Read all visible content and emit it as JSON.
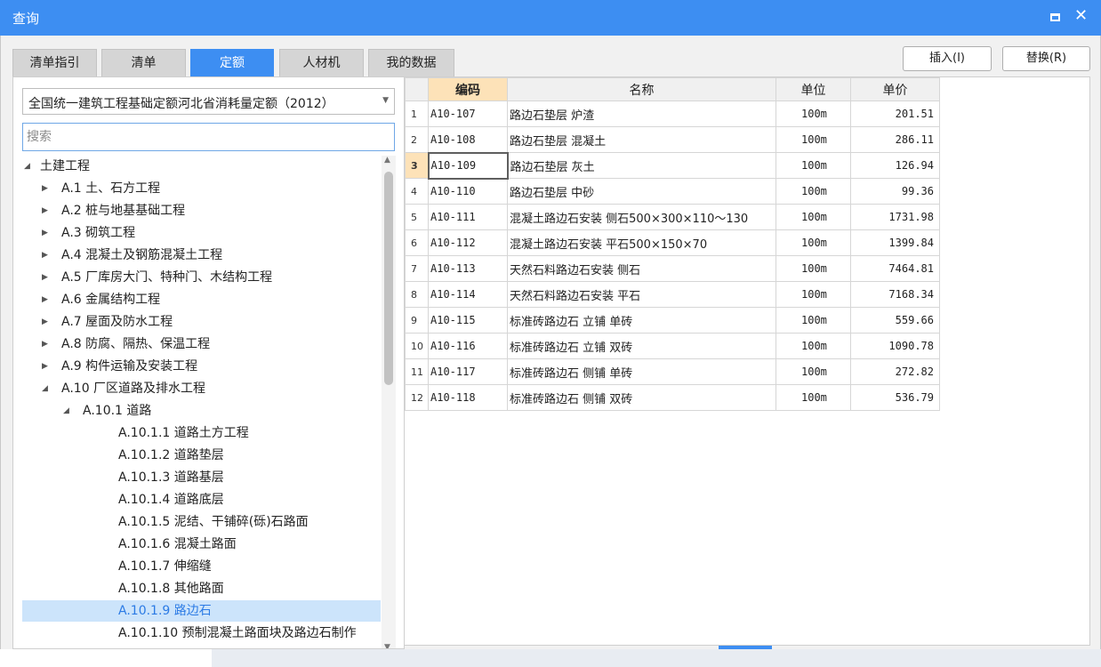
{
  "window": {
    "title": "查询"
  },
  "tabs": [
    {
      "label": "清单指引",
      "active": false
    },
    {
      "label": "清单",
      "active": false
    },
    {
      "label": "定额",
      "active": true
    },
    {
      "label": "人材机",
      "active": false
    },
    {
      "label": "我的数据",
      "active": false
    }
  ],
  "actions": {
    "insert_label": "插入(I)",
    "replace_label": "替换(R)"
  },
  "left": {
    "dropdown_value": "全国统一建筑工程基础定额河北省消耗量定额（2012）",
    "search_placeholder": "搜索"
  },
  "tree": [
    {
      "label": "土建工程",
      "level": 0,
      "arrow": "expanded"
    },
    {
      "label": "A.1 土、石方工程",
      "level": 1,
      "arrow": "collapsed"
    },
    {
      "label": "A.2 桩与地基基础工程",
      "level": 1,
      "arrow": "collapsed"
    },
    {
      "label": "A.3 砌筑工程",
      "level": 1,
      "arrow": "collapsed"
    },
    {
      "label": "A.4 混凝土及钢筋混凝土工程",
      "level": 1,
      "arrow": "collapsed"
    },
    {
      "label": "A.5 厂库房大门、特种门、木结构工程",
      "level": 1,
      "arrow": "collapsed"
    },
    {
      "label": "A.6 金属结构工程",
      "level": 1,
      "arrow": "collapsed"
    },
    {
      "label": "A.7 屋面及防水工程",
      "level": 1,
      "arrow": "collapsed"
    },
    {
      "label": "A.8 防腐、隔热、保温工程",
      "level": 1,
      "arrow": "collapsed"
    },
    {
      "label": "A.9 构件运输及安装工程",
      "level": 1,
      "arrow": "collapsed"
    },
    {
      "label": "A.10 厂区道路及排水工程",
      "level": 1,
      "arrow": "expanded"
    },
    {
      "label": "A.10.1 道路",
      "level": 2,
      "arrow": "expanded"
    },
    {
      "label": "A.10.1.1 道路土方工程",
      "level": 3,
      "arrow": ""
    },
    {
      "label": "A.10.1.2 道路垫层",
      "level": 3,
      "arrow": ""
    },
    {
      "label": "A.10.1.3 道路基层",
      "level": 3,
      "arrow": ""
    },
    {
      "label": "A.10.1.4 道路底层",
      "level": 3,
      "arrow": ""
    },
    {
      "label": "A.10.1.5 泥结、干铺碎(砾)石路面",
      "level": 3,
      "arrow": ""
    },
    {
      "label": "A.10.1.6 混凝土路面",
      "level": 3,
      "arrow": ""
    },
    {
      "label": "A.10.1.7 伸缩缝",
      "level": 3,
      "arrow": ""
    },
    {
      "label": "A.10.1.8 其他路面",
      "level": 3,
      "arrow": ""
    },
    {
      "label": "A.10.1.9 路边石",
      "level": 3,
      "arrow": "",
      "selected": true
    },
    {
      "label": "A.10.1.10 预制混凝土路面块及路边石制作",
      "level": 3,
      "arrow": ""
    }
  ],
  "table": {
    "headers": {
      "code": "编码",
      "name": "名称",
      "unit": "单位",
      "price": "单价"
    },
    "rows": [
      {
        "num": "1",
        "code": "A10-107",
        "name": "路边石垫层 炉渣",
        "unit": "100m",
        "price": "201.51"
      },
      {
        "num": "2",
        "code": "A10-108",
        "name": "路边石垫层 混凝土",
        "unit": "100m",
        "price": "286.11"
      },
      {
        "num": "3",
        "code": "A10-109",
        "name": "路边石垫层 灰土",
        "unit": "100m",
        "price": "126.94",
        "current": true
      },
      {
        "num": "4",
        "code": "A10-110",
        "name": "路边石垫层 中砂",
        "unit": "100m",
        "price": "99.36"
      },
      {
        "num": "5",
        "code": "A10-111",
        "name": "混凝土路边石安装 侧石500×300×110～130",
        "unit": "100m",
        "price": "1731.98"
      },
      {
        "num": "6",
        "code": "A10-112",
        "name": "混凝土路边石安装 平石500×150×70",
        "unit": "100m",
        "price": "1399.84"
      },
      {
        "num": "7",
        "code": "A10-113",
        "name": "天然石料路边石安装 侧石",
        "unit": "100m",
        "price": "7464.81"
      },
      {
        "num": "8",
        "code": "A10-114",
        "name": "天然石料路边石安装 平石",
        "unit": "100m",
        "price": "7168.34"
      },
      {
        "num": "9",
        "code": "A10-115",
        "name": "标准砖路边石 立铺 单砖",
        "unit": "100m",
        "price": "559.66"
      },
      {
        "num": "10",
        "code": "A10-116",
        "name": "标准砖路边石 立铺 双砖",
        "unit": "100m",
        "price": "1090.78"
      },
      {
        "num": "11",
        "code": "A10-117",
        "name": "标准砖路边石 侧铺 单砖",
        "unit": "100m",
        "price": "272.82"
      },
      {
        "num": "12",
        "code": "A10-118",
        "name": "标准砖路边石 侧铺 双砖",
        "unit": "100m",
        "price": "536.79"
      }
    ]
  },
  "colors": {
    "accent": "#3d8ef2",
    "selection": "#cce4fb",
    "current_row": "#fde2b8"
  },
  "icons": {
    "maximize": "maximize-icon",
    "close": "close-icon",
    "expand": "triangle-down-icon",
    "collapse": "triangle-right-icon"
  }
}
